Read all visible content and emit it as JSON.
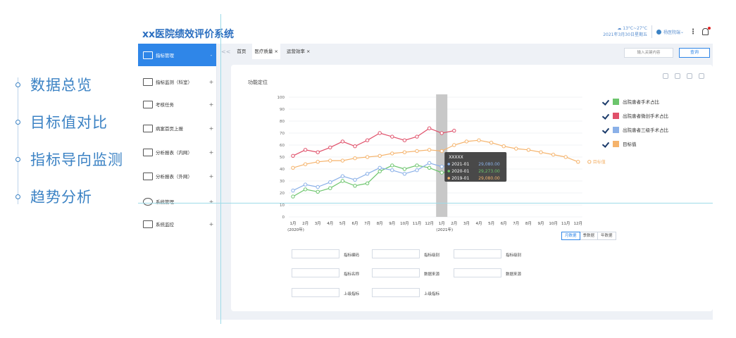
{
  "features": [
    "数据总览",
    "目标值对比",
    "指标导向监测",
    "趋势分析"
  ],
  "header": {
    "title": "xx医院绩效评价系统",
    "weather": "13°C~27°C",
    "date": "2021年3月30日星期五",
    "user": "杨医院端",
    "more": "⋮"
  },
  "sidebar": {
    "items": [
      {
        "label": "指标管理",
        "toggle": "-",
        "active": true
      },
      {
        "label": "指标监测（科室）",
        "toggle": "+"
      },
      {
        "label": "考核任务",
        "toggle": "+"
      },
      {
        "label": "病案首页上报",
        "toggle": "+"
      },
      {
        "label": "分析报表（内网）",
        "toggle": "+"
      },
      {
        "label": "分析报表（外网）",
        "toggle": "+"
      },
      {
        "label": "系统管理",
        "toggle": "+"
      },
      {
        "label": "系统监控",
        "toggle": "+"
      }
    ]
  },
  "tabs": {
    "nav_back": "<<",
    "items": [
      {
        "label": "首页"
      },
      {
        "label": "医疗质量 ×",
        "active": true
      },
      {
        "label": "运营效率 ×"
      }
    ]
  },
  "search": {
    "placeholder": "输入关键内容",
    "button": "查询"
  },
  "panel": {
    "title": "功能定位"
  },
  "chart_data": {
    "type": "line",
    "categories": [
      "1月",
      "2月",
      "3月",
      "4月",
      "5月",
      "6月",
      "7月",
      "8月",
      "9月",
      "10月",
      "11月",
      "12月",
      "1月",
      "2月",
      "3月",
      "4月",
      "5月",
      "6月",
      "7月",
      "8月",
      "9月",
      "10月",
      "11月",
      "12月"
    ],
    "year_labels": [
      "(2020年)",
      "(2021年)"
    ],
    "ylim": [
      0,
      100
    ],
    "yticks": [
      0,
      10,
      20,
      30,
      40,
      50,
      60,
      70,
      80,
      90,
      100
    ],
    "highlight_index": 12,
    "series": [
      {
        "name": "出院患者手术占比",
        "color": "#6cc56c",
        "values": [
          17,
          23,
          21,
          24,
          30,
          26,
          28,
          38,
          43,
          40,
          43,
          41,
          37,
          38
        ]
      },
      {
        "name": "出院患者微创手术占比",
        "color": "#e0506a",
        "values": [
          51,
          56,
          54,
          58,
          63,
          59,
          64,
          70,
          67,
          64,
          67,
          74,
          70,
          72
        ]
      },
      {
        "name": "出院患者三级手术占比",
        "color": "#8ab0e8",
        "values": [
          22,
          27,
          25,
          29,
          34,
          31,
          36,
          41,
          39,
          36,
          39,
          45,
          42,
          44
        ]
      },
      {
        "name": "目标值",
        "color": "#f5b36b",
        "start_index": 0,
        "values": [
          41,
          44,
          46,
          47,
          47,
          49,
          50,
          51,
          53,
          54,
          55,
          56,
          55,
          60,
          63,
          64,
          62,
          59,
          57,
          56,
          54,
          52,
          50,
          46
        ]
      }
    ],
    "target_label": "目标值",
    "tooltip": {
      "title": "XXXXX",
      "rows": [
        {
          "label": "2021-01",
          "value": "29,080.00",
          "color": "#8ab0e8"
        },
        {
          "label": "2020-01",
          "value": "29,273.00",
          "color": "#6cc56c"
        },
        {
          "label": "2019-01",
          "value": "29,080.00",
          "color": "#f5b36b"
        }
      ]
    },
    "legend_placement": "right"
  },
  "period_buttons": [
    "月数据",
    "季数据",
    "年数据"
  ],
  "form": [
    {
      "label": "指标编码"
    },
    {
      "label": "指标级别"
    },
    {
      "label": "指标级别"
    },
    {
      "label": "指标名称"
    },
    {
      "label": "数据来源"
    },
    {
      "label": "数据来源"
    },
    {
      "label": "上级指标"
    },
    {
      "label": "上级指标"
    }
  ]
}
